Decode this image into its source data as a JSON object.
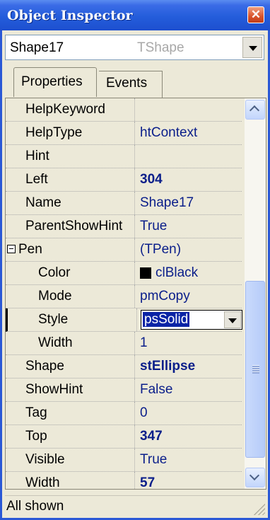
{
  "window": {
    "title": "Object Inspector",
    "close_label": "✕"
  },
  "selector": {
    "object_name": "Shape17",
    "object_type": "TShape"
  },
  "tabs": [
    {
      "label": "Properties",
      "active": true
    },
    {
      "label": "Events",
      "active": false
    }
  ],
  "properties": [
    {
      "name": "HelpKeyword",
      "value": ""
    },
    {
      "name": "HelpType",
      "value": "htContext"
    },
    {
      "name": "Hint",
      "value": ""
    },
    {
      "name": "Left",
      "value": "304",
      "bold": true
    },
    {
      "name": "Name",
      "value": "Shape17"
    },
    {
      "name": "ParentShowHint",
      "value": "True"
    },
    {
      "name": "Pen",
      "value": "(TPen)",
      "expanded": true
    },
    {
      "name": "Color",
      "value": "clBlack",
      "swatch": "#000000"
    },
    {
      "name": "Mode",
      "value": "pmCopy"
    },
    {
      "name": "Style",
      "value": "psSolid",
      "selected": true
    },
    {
      "name": "Width",
      "value": "1"
    },
    {
      "name": "Shape",
      "value": "stEllipse",
      "bold": true
    },
    {
      "name": "ShowHint",
      "value": "False"
    },
    {
      "name": "Tag",
      "value": "0"
    },
    {
      "name": "Top",
      "value": "347",
      "bold": true
    },
    {
      "name": "Visible",
      "value": "True"
    },
    {
      "name": "Width",
      "value": "57",
      "bold": true
    }
  ],
  "status": {
    "text": "All shown"
  },
  "colors": {
    "title_bar": "#245ddb",
    "value_text": "#0a1e8a",
    "selection": "#0a24a6"
  }
}
